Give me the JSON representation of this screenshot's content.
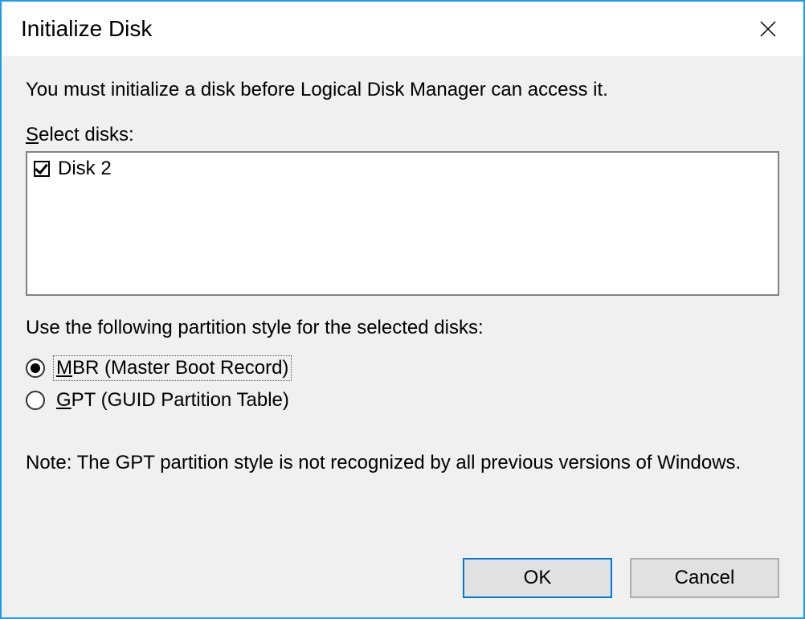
{
  "title": "Initialize Disk",
  "intro": "You must initialize a disk before Logical Disk Manager can access it.",
  "select_label_pre": "S",
  "select_label_post": "elect disks:",
  "disks": [
    {
      "label": "Disk 2",
      "checked": true
    }
  ],
  "partition_label": "Use the following partition style for the selected disks:",
  "options": {
    "mbr_u": "M",
    "mbr_rest": "BR (Master Boot Record)",
    "gpt_u": "G",
    "gpt_rest": "PT (GUID Partition Table)",
    "selected": "mbr"
  },
  "note": "Note: The GPT partition style is not recognized by all previous versions of Windows.",
  "buttons": {
    "ok": "OK",
    "cancel": "Cancel"
  }
}
